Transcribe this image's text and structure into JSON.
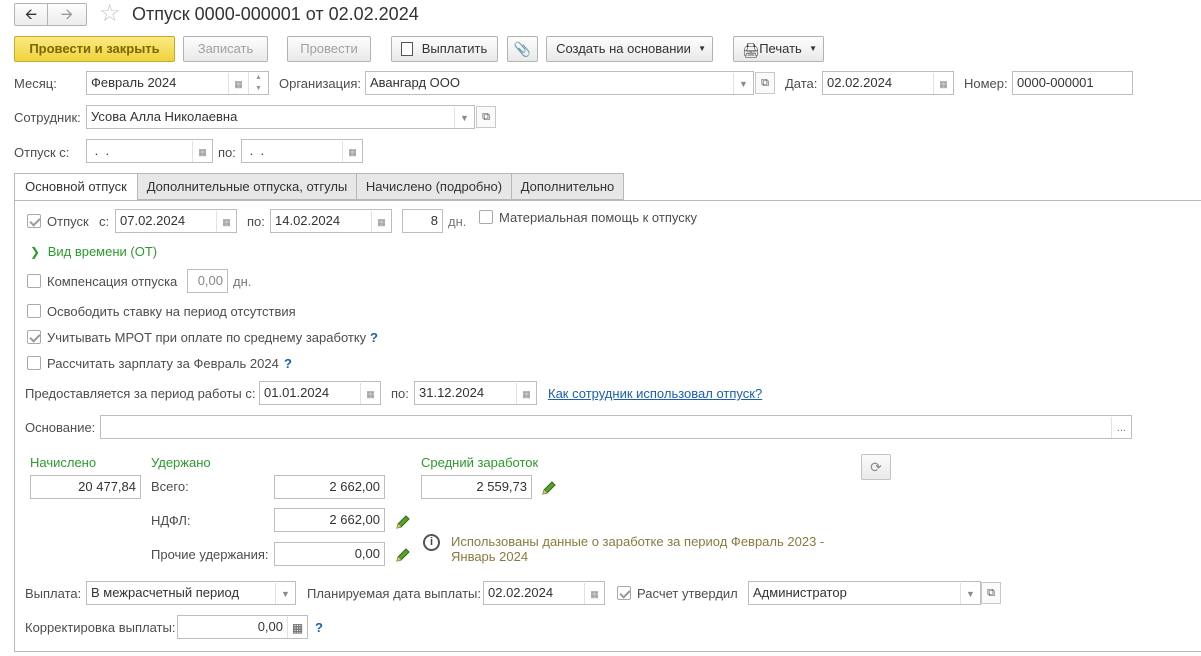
{
  "window": {
    "title": "Отпуск 0000-000001 от 02.02.2024"
  },
  "toolbar": {
    "post_close": "Провести и закрыть",
    "save": "Записать",
    "post": "Провести",
    "pay": "Выплатить",
    "create_based": "Создать на основании",
    "print": "Печать"
  },
  "header": {
    "month_label": "Месяц:",
    "month_value": "Февраль 2024",
    "org_label": "Организация:",
    "org_value": "Авангард ООО",
    "date_label": "Дата:",
    "date_value": "02.02.2024",
    "number_label": "Номер:",
    "number_value": "0000-000001",
    "employee_label": "Сотрудник:",
    "employee_value": "Усова Алла Николаевна",
    "vacation_from_label": "Отпуск с:",
    "vacation_from_value": " .  .",
    "vacation_to_label": "по:",
    "vacation_to_value": " .  ."
  },
  "tabs": [
    "Основной отпуск",
    "Дополнительные отпуска, отгулы",
    "Начислено (подробно)",
    "Дополнительно"
  ],
  "main": {
    "vac_label": "Отпуск",
    "vac_from_label": "с:",
    "vac_from": "07.02.2024",
    "vac_to_label": "по:",
    "vac_to": "14.02.2024",
    "days": "8",
    "days_unit": "дн.",
    "material_help": "Материальная помощь к отпуску",
    "time_type": "Вид времени (ОТ)",
    "compensation_label": "Компенсация отпуска",
    "compensation_value": "0,00",
    "compensation_unit": "дн.",
    "free_rate": "Освободить ставку на период отсутствия",
    "mrot": "Учитывать МРОТ при оплате по среднему заработку",
    "calc_salary": "Рассчитать зарплату за Февраль 2024",
    "q": "?",
    "period_label": "Предоставляется за период работы с:",
    "period_from": "01.01.2024",
    "period_to_label": "по:",
    "period_to": "31.12.2024",
    "period_link": "Как сотрудник использовал отпуск?",
    "basis_label": "Основание:",
    "basis_value": "",
    "basis_btn": "...",
    "accrued_label": "Начислено",
    "accrued_value": "20 477,84",
    "withheld_label": "Удержано",
    "total_label": "Всего:",
    "total_value": "2 662,00",
    "ndfl_label": "НДФЛ:",
    "ndfl_value": "2 662,00",
    "other_label": "Прочие удержания:",
    "other_value": "0,00",
    "avg_label": "Средний заработок",
    "avg_value": "2 559,73",
    "info_text": "Использованы данные о заработке за период Февраль 2023 - Январь 2024"
  },
  "footer": {
    "payment_label": "Выплата:",
    "payment_value": "В межрасчетный период",
    "planned_label": "Планируемая дата выплаты:",
    "planned_value": "02.02.2024",
    "approved_label": "Расчет утвердил",
    "approved_value": "Администратор",
    "correction_label": "Корректировка выплаты:",
    "correction_value": "0,00"
  },
  "colors": {
    "accent_green": "#2c9a2c",
    "primary_button": "#f0d33e",
    "link": "#1a5fb4"
  }
}
